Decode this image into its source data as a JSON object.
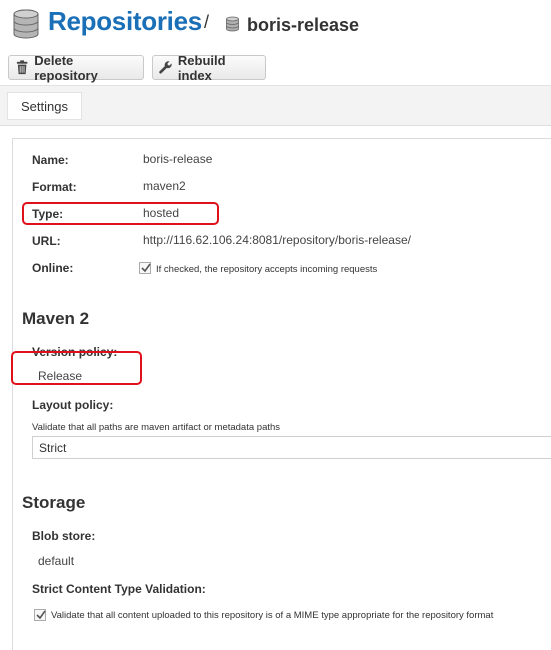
{
  "header": {
    "title": "Repositories",
    "separator": "/",
    "repo_name": "boris-release"
  },
  "toolbar": {
    "delete_label": "Delete repository",
    "rebuild_label": "Rebuild index"
  },
  "tabs": [
    {
      "label": "Settings"
    }
  ],
  "settings": {
    "name_label": "Name:",
    "name_value": "boris-release",
    "format_label": "Format:",
    "format_value": "maven2",
    "type_label": "Type:",
    "type_value": "hosted",
    "url_label": "URL:",
    "url_value": "http://116.62.106.24:8081/repository/boris-release/",
    "online_label": "Online:",
    "online_checked": true,
    "online_help": "If checked, the repository accepts incoming requests"
  },
  "maven": {
    "section_title": "Maven 2",
    "version_policy_label": "Version policy:",
    "version_policy_value": "Release",
    "layout_policy_label": "Layout policy:",
    "layout_policy_help": "Validate that all paths are maven artifact or metadata paths",
    "layout_policy_value": "Strict"
  },
  "storage": {
    "section_title": "Storage",
    "blob_store_label": "Blob store:",
    "blob_store_value": "default",
    "strict_label": "Strict Content Type Validation:",
    "strict_checked": true,
    "strict_help": "Validate that all content uploaded to this repository is of a MIME type appropriate for the repository format"
  },
  "colors": {
    "title_blue": "#1a6fb7",
    "highlight_red": "#e0101a"
  },
  "icons": [
    "database-icon",
    "trash-icon",
    "wrench-icon",
    "checkmark-icon"
  ]
}
